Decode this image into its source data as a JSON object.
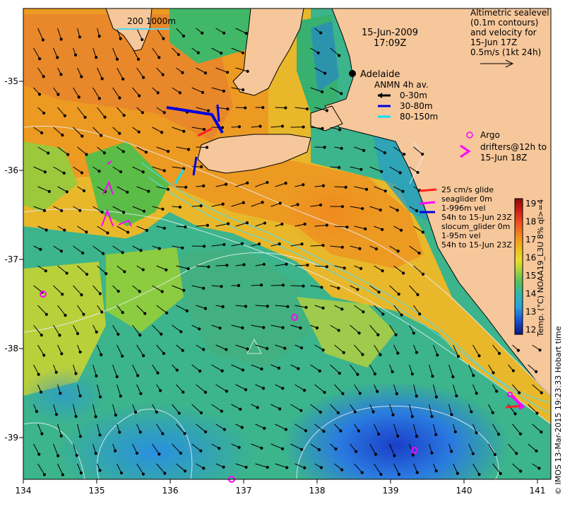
{
  "header": {
    "date": "15-Jun-2009",
    "time": "17:09Z",
    "scale_label": "200  1000m"
  },
  "sealevel_note": {
    "lines": [
      "Altimetric sealevel",
      "(0.1m contours)",
      "and velocity for",
      "15-Jun 17Z",
      "0.5m/s (1kt 24h)"
    ]
  },
  "places": {
    "adelaide": "Adelaide"
  },
  "anmn_legend": {
    "title": "ANMN 4h av.",
    "items": [
      {
        "label": "0-30m",
        "color": "#000000"
      },
      {
        "label": "30-80m",
        "color": "#0000dd"
      },
      {
        "label": "80-150m",
        "color": "#00e0ff"
      }
    ]
  },
  "argo_legend": {
    "argo": "Argo",
    "drifters": "drifters@12h to",
    "drifters2": "15-Jun 18Z",
    "color": "#ff00ff"
  },
  "glider_legend": {
    "lines": [
      "25 cm/s glide",
      "seaglider 0m",
      "1-996m vel",
      "54h to 15-Jun 23Z",
      "slocum_glider 0m",
      "1-95m vel",
      "54h to 15-Jun 23Z"
    ],
    "arrow_colors": [
      "#ff2020",
      "#ff00ff",
      "#0000dd"
    ]
  },
  "colorbar": {
    "title": "Temp. (°C) NOAA19_L3U 8% ql>=4",
    "ticks": [
      "19",
      "18",
      "17",
      "16",
      "15",
      "14",
      "13",
      "12"
    ],
    "colors": [
      "#8a0a0a",
      "#cc1a10",
      "#ee5020",
      "#f5901e",
      "#f0c020",
      "#e8e028",
      "#b8d838",
      "#70c848",
      "#40b878",
      "#30b8a8",
      "#28a8d8",
      "#2878e8",
      "#1a3ec8",
      "#0a1a80"
    ]
  },
  "credit": "© IMOS 13-Mar-2015 19:23:33 Hobart time",
  "axes": {
    "x_ticks": [
      "134",
      "135",
      "136",
      "137",
      "138",
      "139",
      "140",
      "141"
    ],
    "y_ticks": [
      "-35",
      "-36",
      "-37",
      "-38",
      "-39"
    ]
  }
}
